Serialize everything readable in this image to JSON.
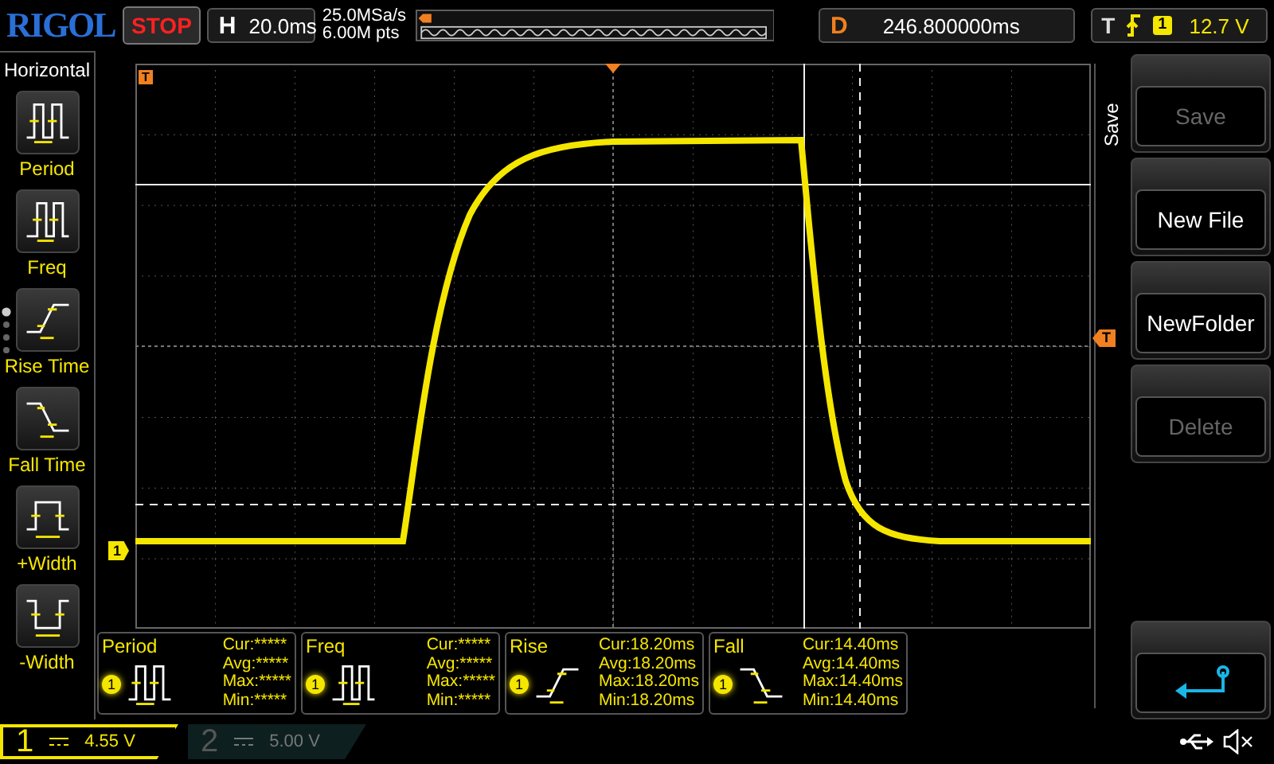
{
  "brand": "RIGOL",
  "run_state": "STOP",
  "horizontal": {
    "label": "H",
    "timebase": "20.0ms",
    "sample_rate": "25.0MSa/s",
    "memory_depth": "6.00M pts"
  },
  "delay": {
    "label": "D",
    "value": "246.800000ms"
  },
  "trigger": {
    "label": "T",
    "channel": "1",
    "level": "12.7 V"
  },
  "sidebar": {
    "title": "Horizontal",
    "items": [
      {
        "label": "Period",
        "kind": "period"
      },
      {
        "label": "Freq",
        "kind": "freq"
      },
      {
        "label": "Rise Time",
        "kind": "rise"
      },
      {
        "label": "Fall Time",
        "kind": "fall"
      },
      {
        "label": "+Width",
        "kind": "pwidth"
      },
      {
        "label": "-Width",
        "kind": "nwidth"
      }
    ]
  },
  "markers": {
    "channel": "1",
    "trigger_level": "T",
    "trigger_top": "T"
  },
  "measurements": [
    {
      "title": "Period",
      "channel": "1",
      "kind": "period",
      "stats": [
        "Cur:*****",
        "Avg:*****",
        "Max:*****",
        "Min:*****"
      ]
    },
    {
      "title": "Freq",
      "channel": "1",
      "kind": "freq",
      "stats": [
        "Cur:*****",
        "Avg:*****",
        "Max:*****",
        "Min:*****"
      ]
    },
    {
      "title": "Rise",
      "channel": "1",
      "kind": "rise",
      "stats": [
        "Cur:18.20ms",
        "Avg:18.20ms",
        "Max:18.20ms",
        "Min:18.20ms"
      ]
    },
    {
      "title": "Fall",
      "channel": "1",
      "kind": "fall",
      "stats": [
        "Cur:14.40ms",
        "Avg:14.40ms",
        "Max:14.40ms",
        "Min:14.40ms"
      ]
    }
  ],
  "channels": [
    {
      "number": "1",
      "scale": "4.55 V",
      "on": true
    },
    {
      "number": "2",
      "scale": "5.00 V",
      "on": false
    }
  ],
  "menu": {
    "title": "Save",
    "buttons": [
      {
        "label": "Save",
        "disabled": true
      },
      {
        "label": "New File",
        "disabled": false
      },
      {
        "label": "NewFolder",
        "disabled": false
      },
      {
        "label": "Delete",
        "disabled": true
      }
    ]
  }
}
